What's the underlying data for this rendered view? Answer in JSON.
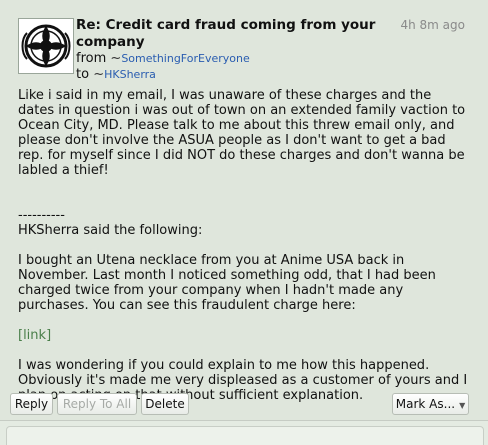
{
  "message": {
    "subject": "Re: Credit card fraud coming from your company",
    "age": "4h 8m ago",
    "from_label": "from",
    "from_user": "SomethingForEveryone",
    "to_label": "to",
    "to_user": "HKSherra",
    "tilde": "~",
    "paragraphs": [
      "Like i said in my email, I was unaware of these charges and the dates in question i was out of town on an extended family vaction to Ocean City, MD. Please talk to me about this threw email only, and please don't involve the ASUA people as I don't want to get a bad rep. for myself since I did NOT do these charges and don't wanna be labled a thief!",
      "----------",
      "HKSherra said the following:",
      "I bought an Utena necklace from you at Anime USA back in November. Last month I noticed something odd, that I had been charged twice from your company when I hadn't made any purchases. You can see this fraudulent charge here:",
      "I was wondering if you could explain to me how this happened. Obviously it's made me very displeased as a customer of yours and I plan on acting on that without sufficient explanation."
    ],
    "link_text": "[link]"
  },
  "actions": {
    "reply": "Reply",
    "reply_all": "Reply To All",
    "delete": "Delete",
    "mark_as": "Mark As..."
  },
  "icons": {
    "avatar": "ornate-circle-emblem-icon",
    "dropdown": "caret-down-icon"
  },
  "colors": {
    "background": "#dfe6dc",
    "username_link": "#2a5db0",
    "body_link": "#4a7f4a",
    "timestamp": "#8a8a8a"
  }
}
